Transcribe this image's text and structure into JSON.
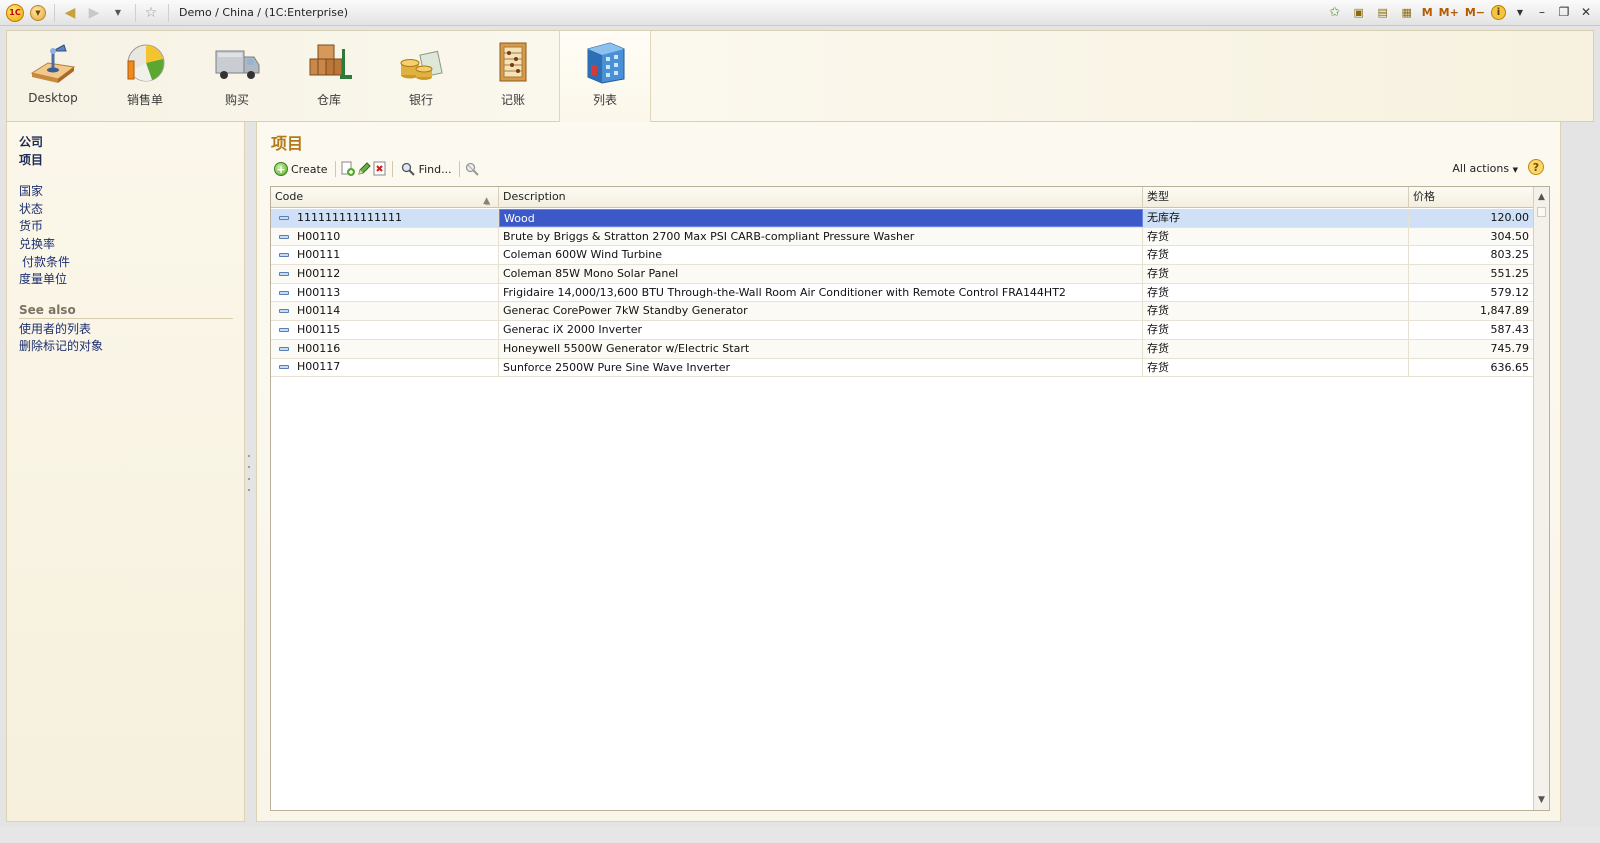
{
  "window": {
    "title": "Demo / China /  (1C:Enterprise)",
    "logo_text": "1C"
  },
  "toolbar_right": {
    "m_label": "M",
    "mplus_label": "M+",
    "mminus_label": "M−",
    "info_label": "i"
  },
  "sections": [
    {
      "label": "Desktop",
      "icon": "desktop-icon"
    },
    {
      "label": "销售单",
      "icon": "sales-chart-icon"
    },
    {
      "label": "购买",
      "icon": "truck-icon"
    },
    {
      "label": "仓库",
      "icon": "warehouse-boxes-icon"
    },
    {
      "label": "银行",
      "icon": "coins-icon"
    },
    {
      "label": "记账",
      "icon": "ledger-abacus-icon"
    },
    {
      "label": "列表",
      "icon": "building-list-icon"
    }
  ],
  "leftnav": {
    "primary": [
      "公司",
      "项目"
    ],
    "secondary": [
      "国家",
      "状态",
      "货币",
      "兑换率",
      "付款条件",
      "度量单位"
    ],
    "see_also_title": "See also",
    "see_also": [
      "使用者的列表",
      "删除标记的对象"
    ]
  },
  "main": {
    "title": "项目",
    "commands": {
      "create": "Create",
      "find": "Find...",
      "all_actions": "All actions",
      "help": "?"
    },
    "columns": [
      "Code",
      "Description",
      "类型",
      "价格"
    ],
    "rows": [
      {
        "code": "111111111111111",
        "description": "Wood",
        "type": "无库存",
        "price": "120.00"
      },
      {
        "code": "H00110",
        "description": "Brute by Briggs & Stratton 2700 Max PSI CARB-compliant Pressure Washer",
        "type": "存货",
        "price": "304.50"
      },
      {
        "code": "H00111",
        "description": "Coleman 600W Wind Turbine",
        "type": "存货",
        "price": "803.25"
      },
      {
        "code": "H00112",
        "description": "Coleman 85W Mono Solar Panel",
        "type": "存货",
        "price": "551.25"
      },
      {
        "code": "H00113",
        "description": "Frigidaire 14,000/13,600 BTU Through-the-Wall Room Air Conditioner with Remote Control FRA144HT2",
        "type": "存货",
        "price": "579.12"
      },
      {
        "code": "H00114",
        "description": "Generac CorePower 7kW Standby Generator",
        "type": "存货",
        "price": "1,847.89"
      },
      {
        "code": "H00115",
        "description": "Generac iX 2000 Inverter",
        "type": "存货",
        "price": "587.43"
      },
      {
        "code": "H00116",
        "description": "Honeywell 5500W Generator w/Electric Start",
        "type": "存货",
        "price": "745.79"
      },
      {
        "code": "H00117",
        "description": "Sunforce 2500W Pure Sine Wave Inverter",
        "type": "存货",
        "price": "636.65"
      }
    ]
  }
}
